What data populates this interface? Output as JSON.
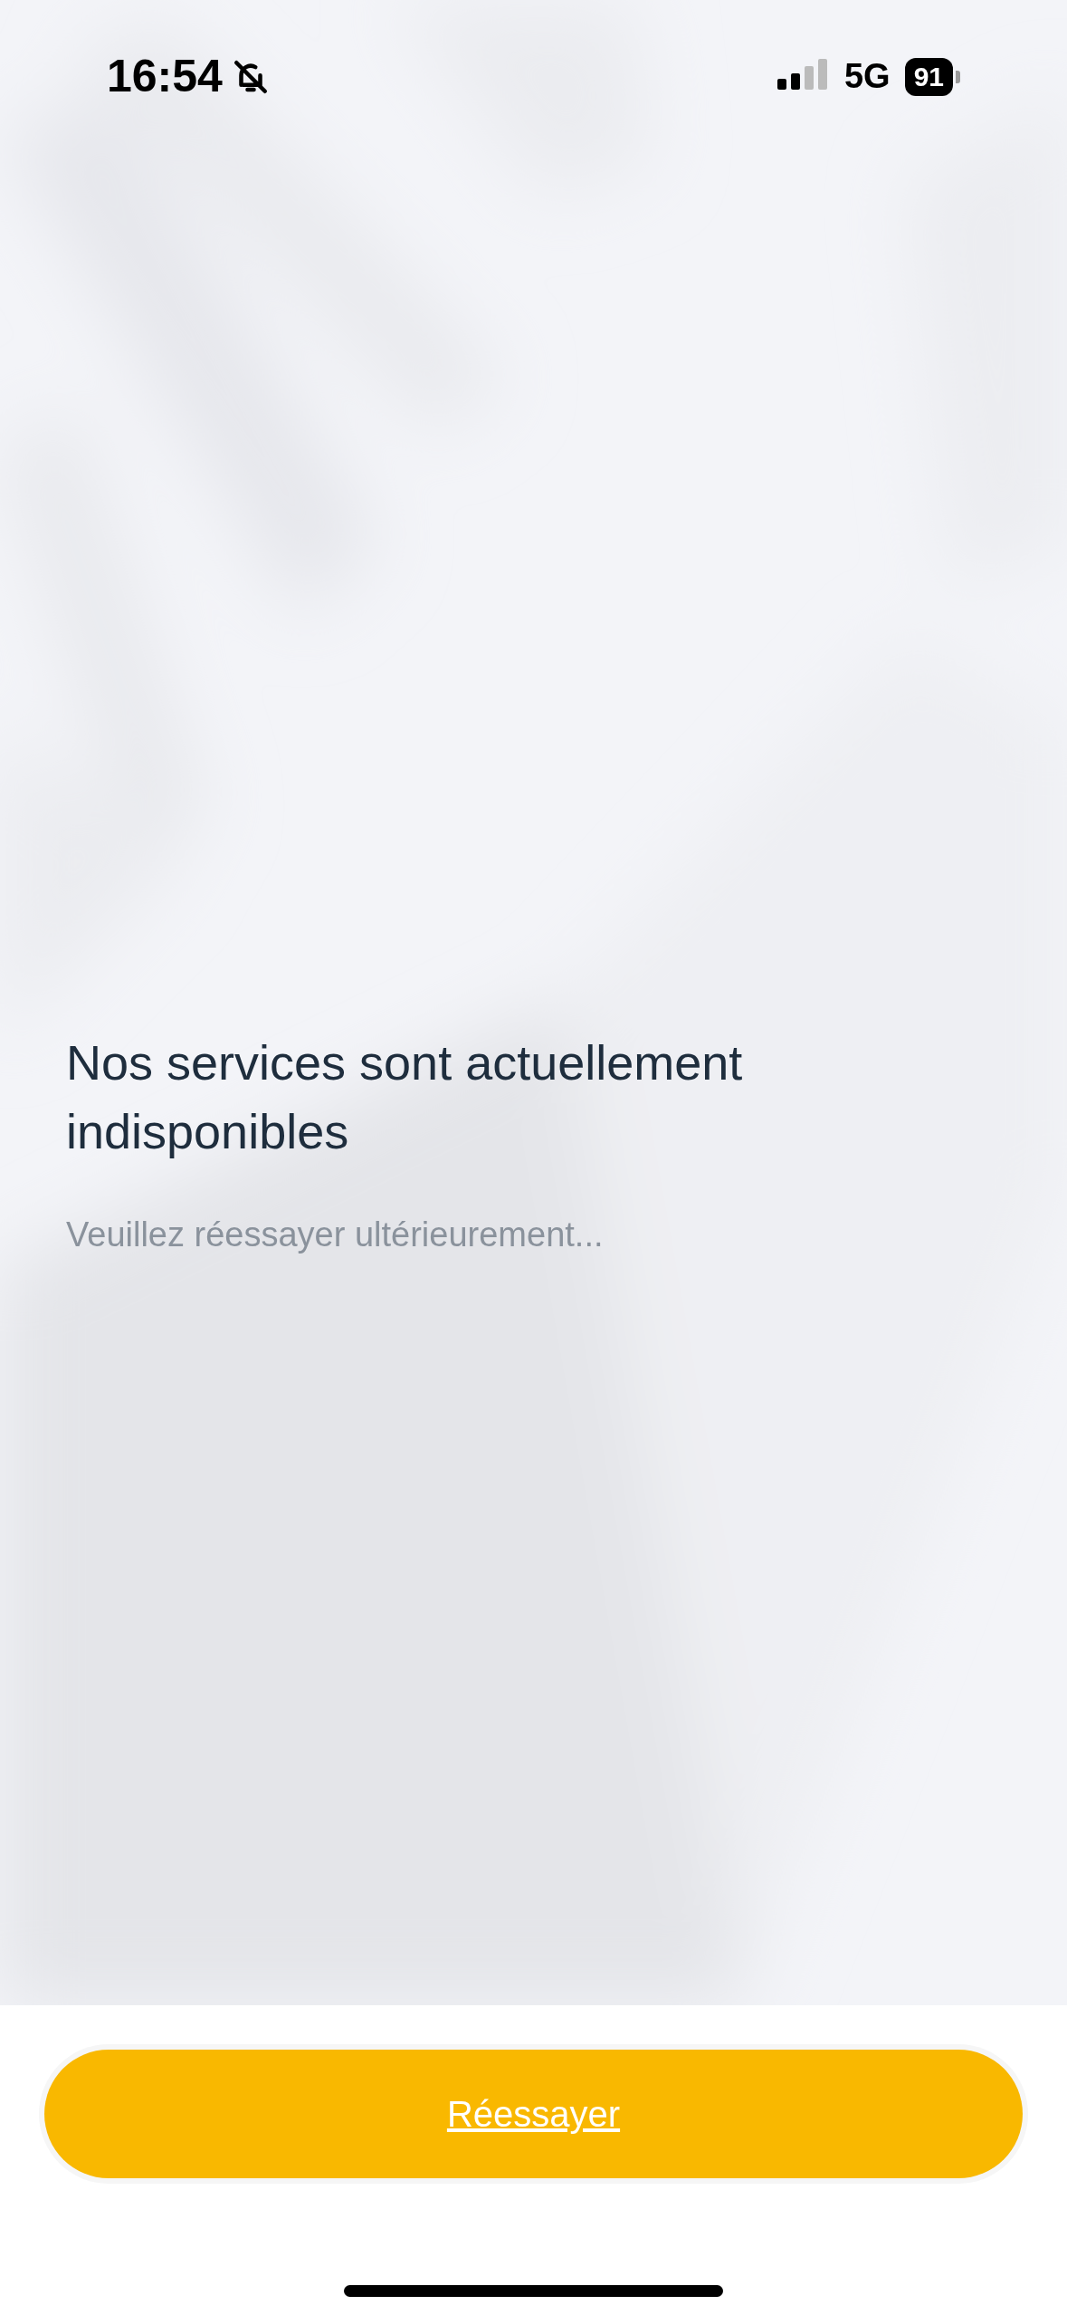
{
  "status_bar": {
    "time": "16:54",
    "silent": true,
    "network": "5G",
    "battery": "91"
  },
  "message": {
    "title": "Nos services sont actuellement indisponibles",
    "subtitle": "Veuillez réessayer ultérieurement..."
  },
  "buttons": [
    {
      "label": "Réessayer"
    }
  ]
}
